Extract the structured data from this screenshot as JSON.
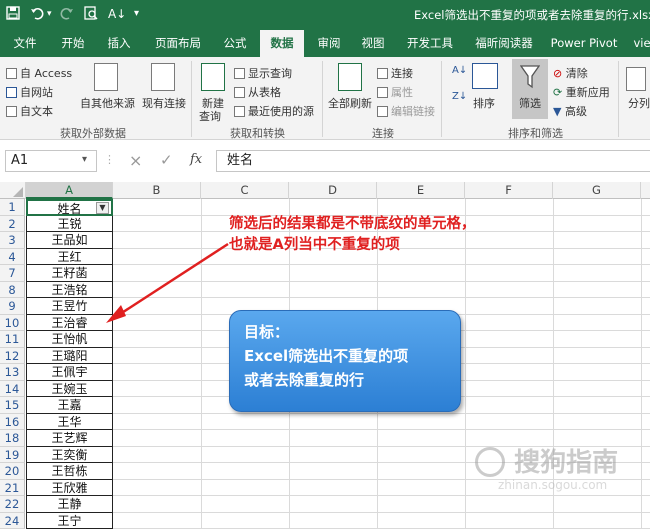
{
  "window": {
    "title": "Excel筛选出不重复的项或者去除重复的行.xlsx [月"
  },
  "quick_access": {
    "save_icon": "save-icon",
    "undo_icon": "undo-icon",
    "redo_icon": "redo-icon",
    "preview_icon": "print-preview-icon",
    "sort_icon": "sort-icon",
    "more_icon": "customize-icon"
  },
  "tabs": [
    "文件",
    "开始",
    "插入",
    "页面布局",
    "公式",
    "数据",
    "审阅",
    "视图",
    "开发工具",
    "福昕阅读器",
    "Power Pivot",
    "vie"
  ],
  "active_tab": "数据",
  "ribbon": {
    "external": {
      "access": "自 Access",
      "web": "自网站",
      "text": "自文本",
      "other": "自其他来源",
      "existing": "现有连接",
      "group": "获取外部数据"
    },
    "transform": {
      "new_query": "新建",
      "new_query2": "查询",
      "show_query": "显示查询",
      "from_table": "从表格",
      "recent": "最近使用的源",
      "group": "获取和转换"
    },
    "connections": {
      "refresh": "全部刷新",
      "connections": "连接",
      "properties": "属性",
      "edit_links": "编辑链接",
      "group": "连接"
    },
    "sort_filter": {
      "sort": "排序",
      "filter": "筛选",
      "clear": "清除",
      "reapply": "重新应用",
      "advanced": "高级",
      "group": "排序和筛选"
    },
    "more": {
      "split": "分列"
    }
  },
  "formula_bar": {
    "name_box": "A1",
    "cancel": "×",
    "enter": "✓",
    "fx": "fx",
    "value": "姓名"
  },
  "columns": [
    "A",
    "B",
    "C",
    "D",
    "E",
    "F",
    "G"
  ],
  "rows": [
    {
      "num": "1",
      "value": "姓名"
    },
    {
      "num": "2",
      "value": "王锐"
    },
    {
      "num": "3",
      "value": "王品如"
    },
    {
      "num": "4",
      "value": "王红"
    },
    {
      "num": "7",
      "value": "王籽菡"
    },
    {
      "num": "8",
      "value": "王浩铭"
    },
    {
      "num": "9",
      "value": "王昱竹"
    },
    {
      "num": "10",
      "value": "王治睿"
    },
    {
      "num": "11",
      "value": "王怡帆"
    },
    {
      "num": "12",
      "value": "王璐阳"
    },
    {
      "num": "13",
      "value": "王佩宇"
    },
    {
      "num": "14",
      "value": "王婉玉"
    },
    {
      "num": "15",
      "value": "王嘉"
    },
    {
      "num": "16",
      "value": "王华"
    },
    {
      "num": "18",
      "value": "王艺辉"
    },
    {
      "num": "19",
      "value": "王奕衡"
    },
    {
      "num": "20",
      "value": "王哲栋"
    },
    {
      "num": "21",
      "value": "王欣雅"
    },
    {
      "num": "22",
      "value": "王静"
    },
    {
      "num": "24",
      "value": "王宁"
    }
  ],
  "annotation": {
    "line1": "筛选后的结果都是不带底纹的单元格，",
    "line2": "也就是A列当中不重复的项",
    "color": "#e02020"
  },
  "callout": {
    "line1": "目标：",
    "line2": "Excel筛选出不重复的项",
    "line3": "或者去除重复的行"
  },
  "watermark": {
    "main": "搜狗指南",
    "sub": "zhinan.sogou.com"
  },
  "colors": {
    "excel_green": "#217346",
    "row_number_blue": "#2b5797",
    "callout_blue": "#3d8ee0"
  }
}
